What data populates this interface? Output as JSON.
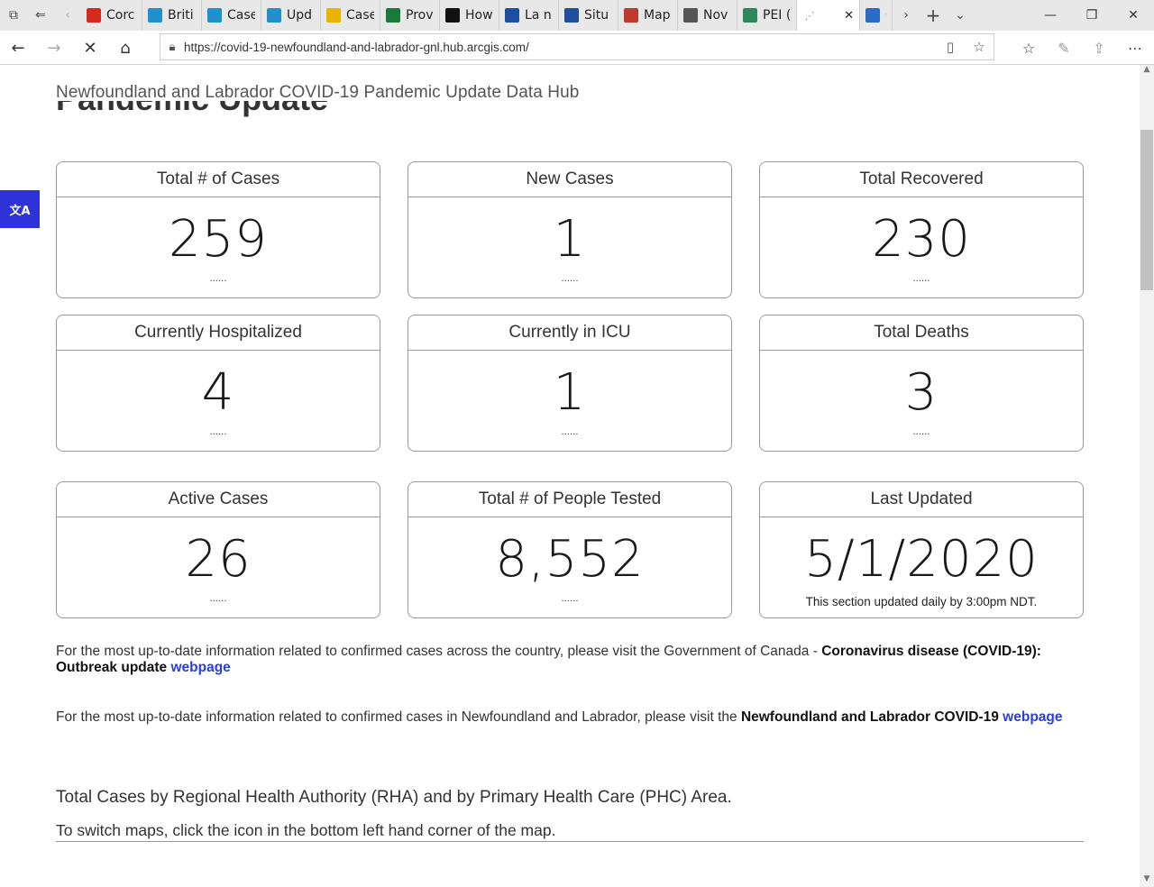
{
  "browser": {
    "tabs": [
      {
        "label": "Corc",
        "icon": "maple-leaf-icon",
        "color": "#d52b1e"
      },
      {
        "label": "Briti",
        "icon": "bc-icon",
        "color": "#1f8fce"
      },
      {
        "label": "Case",
        "icon": "alberta-icon",
        "color": "#1f8fce"
      },
      {
        "label": "Upd",
        "icon": "alberta-icon",
        "color": "#1f8fce"
      },
      {
        "label": "Case",
        "icon": "saskatchewan-icon",
        "color": "#e8b400"
      },
      {
        "label": "Prov",
        "icon": "manitoba-icon",
        "color": "#1a7a3a"
      },
      {
        "label": "How",
        "icon": "ontario-icon",
        "color": "#111111"
      },
      {
        "label": "La n",
        "icon": "quebec-icon",
        "color": "#1c4fa0"
      },
      {
        "label": "Situ",
        "icon": "quebec-icon",
        "color": "#1c4fa0"
      },
      {
        "label": "Map",
        "icon": "nb-icon",
        "color": "#c0392b"
      },
      {
        "label": "Nov",
        "icon": "ns-icon",
        "color": "#555555"
      },
      {
        "label": "PEI (",
        "icon": "pei-icon",
        "color": "#2b8a5a"
      },
      {
        "label": "",
        "icon": "loading-icon",
        "color": "#777777"
      },
      {
        "label": "C",
        "icon": "arcgis-icon",
        "color": "#2a6bc8"
      }
    ],
    "url": "https://covid-19-newfoundland-and-labrador-gnl.hub.arcgis.com/"
  },
  "page": {
    "site_title": "Newfoundland and Labrador COVID-19 Pandemic Update Data Hub",
    "section_title": "Pandemic Update",
    "cards": [
      {
        "title": "Total # of Cases",
        "value": "259",
        "footer": "......"
      },
      {
        "title": "New Cases",
        "value": "1",
        "footer": "......"
      },
      {
        "title": "Total Recovered",
        "value": "230",
        "footer": "......"
      },
      {
        "title": "Currently Hospitalized",
        "value": "4",
        "footer": "......"
      },
      {
        "title": "Currently in ICU",
        "value": "1",
        "footer": "......"
      },
      {
        "title": "Total Deaths",
        "value": "3",
        "footer": "......"
      },
      {
        "title": "Active Cases",
        "value": "26",
        "footer": "......"
      },
      {
        "title": "Total # of People Tested",
        "value": "8,552",
        "footer": "......"
      },
      {
        "title": "Last Updated",
        "value": "5/1/2020",
        "footer": "This section updated daily by 3:00pm NDT."
      }
    ],
    "para1": {
      "text": "For the most up-to-date information related to confirmed cases across the country, please visit the Government of Canada - ",
      "bold": "Coronavirus disease (COVID-19): Outbreak update",
      "link": "webpage"
    },
    "para2": {
      "text": "For the most up-to-date information related to confirmed cases in Newfoundland and Labrador, please visit the ",
      "bold": "Newfoundland and Labrador COVID-19",
      "link": "webpage"
    },
    "rha_heading": "Total Cases by Regional Health Authority (RHA) and by Primary Health Care (PHC) Area.",
    "map_hint": "To switch maps, click the icon in the bottom left hand corner of the map."
  }
}
